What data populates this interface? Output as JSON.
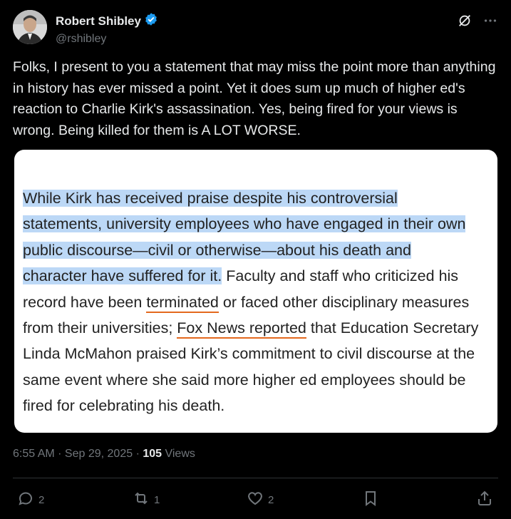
{
  "author": {
    "display_name": "Robert Shibley",
    "handle": "@rshibley",
    "verified": true
  },
  "tweet": {
    "text": "Folks, I present to you a statement that may miss the point more than anything in history has ever missed a point. Yet it does sum up much of higher ed's reaction to Charlie Kirk's assassination. Yes, being fired for your views is wrong. Being killed for them is A LOT WORSE."
  },
  "quote_image": {
    "highlighted_text": "While Kirk has received praise despite his controversial\nstatements, university employees who have engaged in their own\npublic discourse—civil or otherwise—about his death and\ncharacter have suffered for it.",
    "text_a": " Faculty and staff who criticized his\nrecord have been ",
    "link_1": "terminated",
    "text_b": " or faced other disciplinary measures\nfrom their universities; ",
    "link_2": "Fox News reported",
    "text_c": " that Education Secretary\nLinda McMahon praised Kirk’s commitment to civil discourse at the\nsame event where she said more higher ed employees should be\nfired for celebrating his death.",
    "highlight_color": "#bcd8f6",
    "underline_color": "#e4691e"
  },
  "meta": {
    "time": "6:55 AM",
    "sep1": " · ",
    "date": "Sep 29, 2025",
    "sep2": " · ",
    "views_count": "105",
    "views_label": " Views"
  },
  "actions": {
    "reply_count": "2",
    "retweet_count": "1",
    "like_count": "2"
  },
  "colors": {
    "background": "#000000",
    "text": "#e7e9ea",
    "muted": "#71767b",
    "verified": "#1d9bf0"
  }
}
